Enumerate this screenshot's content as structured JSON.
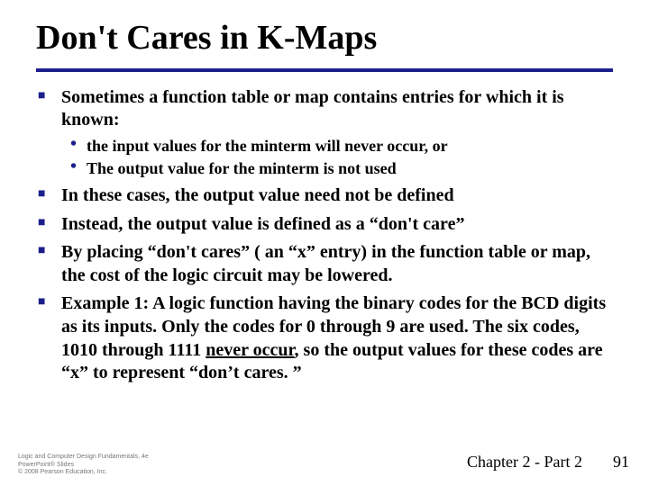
{
  "title": "Don't Cares in K-Maps",
  "bullets": {
    "b1": "Sometimes a function table or map contains entries for which it is known:",
    "sub1": "the input values for the minterm will never occur, or",
    "sub2": "The output value for the minterm is not used",
    "b2": "In these cases, the output value need not be defined",
    "b3": "Instead, the output value is defined as a “don't care”",
    "b4": "By placing “don't cares” ( an “x” entry) in the function table or map, the cost of the logic circuit may be lowered.",
    "b5_pre": "Example  1:  A logic function having the binary codes for the BCD digits as its inputs. Only the codes for 0 through 9 are used.  The six codes, 1010 through 1111 ",
    "b5_underline": "never occur",
    "b5_post": ", so the output values for these codes are “x” to represent “don’t cares. ”"
  },
  "footer": {
    "line1": "Logic and Computer Design Fundamentals, 4e",
    "line2": "PowerPoint® Slides",
    "line3": "© 2008 Pearson Education, Inc.",
    "chapter": "Chapter 2 - Part 2",
    "page": "91"
  }
}
